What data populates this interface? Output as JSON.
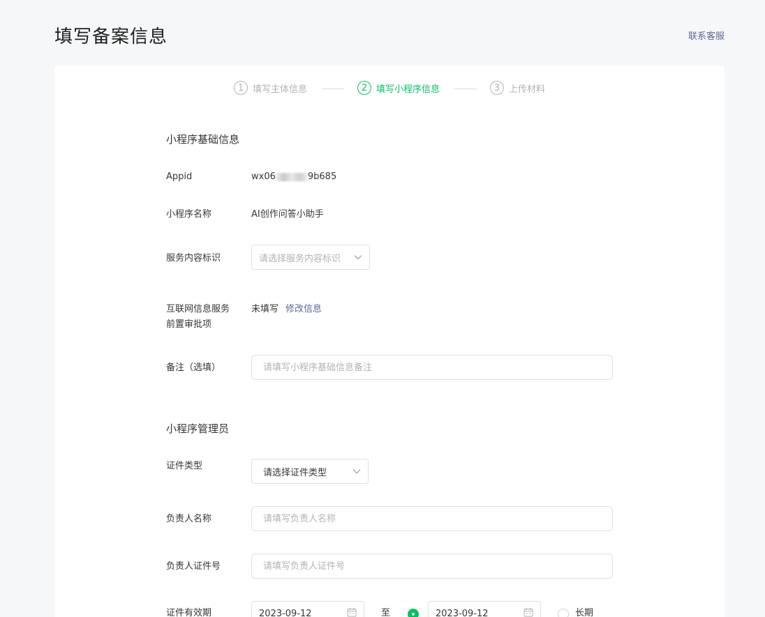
{
  "header": {
    "title": "填写备案信息",
    "contact_link": "联系客服"
  },
  "steps": [
    {
      "num": "1",
      "label": "填写主体信息",
      "active": false
    },
    {
      "num": "2",
      "label": "填写小程序信息",
      "active": true
    },
    {
      "num": "3",
      "label": "上传材料",
      "active": false
    }
  ],
  "basic_info": {
    "section_title": "小程序基础信息",
    "appid_label": "Appid",
    "appid_prefix": "wx06",
    "appid_suffix": "9b685",
    "name_label": "小程序名称",
    "name_value": "AI创作问答小助手",
    "service_label": "服务内容标识",
    "service_placeholder": "请选择服务内容标识",
    "icp_label_line1": "互联网信息服务",
    "icp_label_line2": "前置审批项",
    "icp_value": "未填写",
    "icp_link": "修改信息",
    "remark_label": "备注（选填）",
    "remark_placeholder": "请填写小程序基础信息备注"
  },
  "admin": {
    "section_title": "小程序管理员",
    "id_type_label": "证件类型",
    "id_type_value": "请选择证件类型",
    "name_label": "负责人名称",
    "name_placeholder": "请填写负责人名称",
    "id_no_label": "负责人证件号",
    "id_no_placeholder": "请填写负责人证件号",
    "validity_label": "证件有效期",
    "start_date": "2023-09-12",
    "to_label": "至",
    "end_date": "2023-09-12",
    "long_term_label": "长期"
  },
  "colors": {
    "accent": "#07c160",
    "link": "#576b95",
    "placeholder": "#b2b2b2"
  }
}
